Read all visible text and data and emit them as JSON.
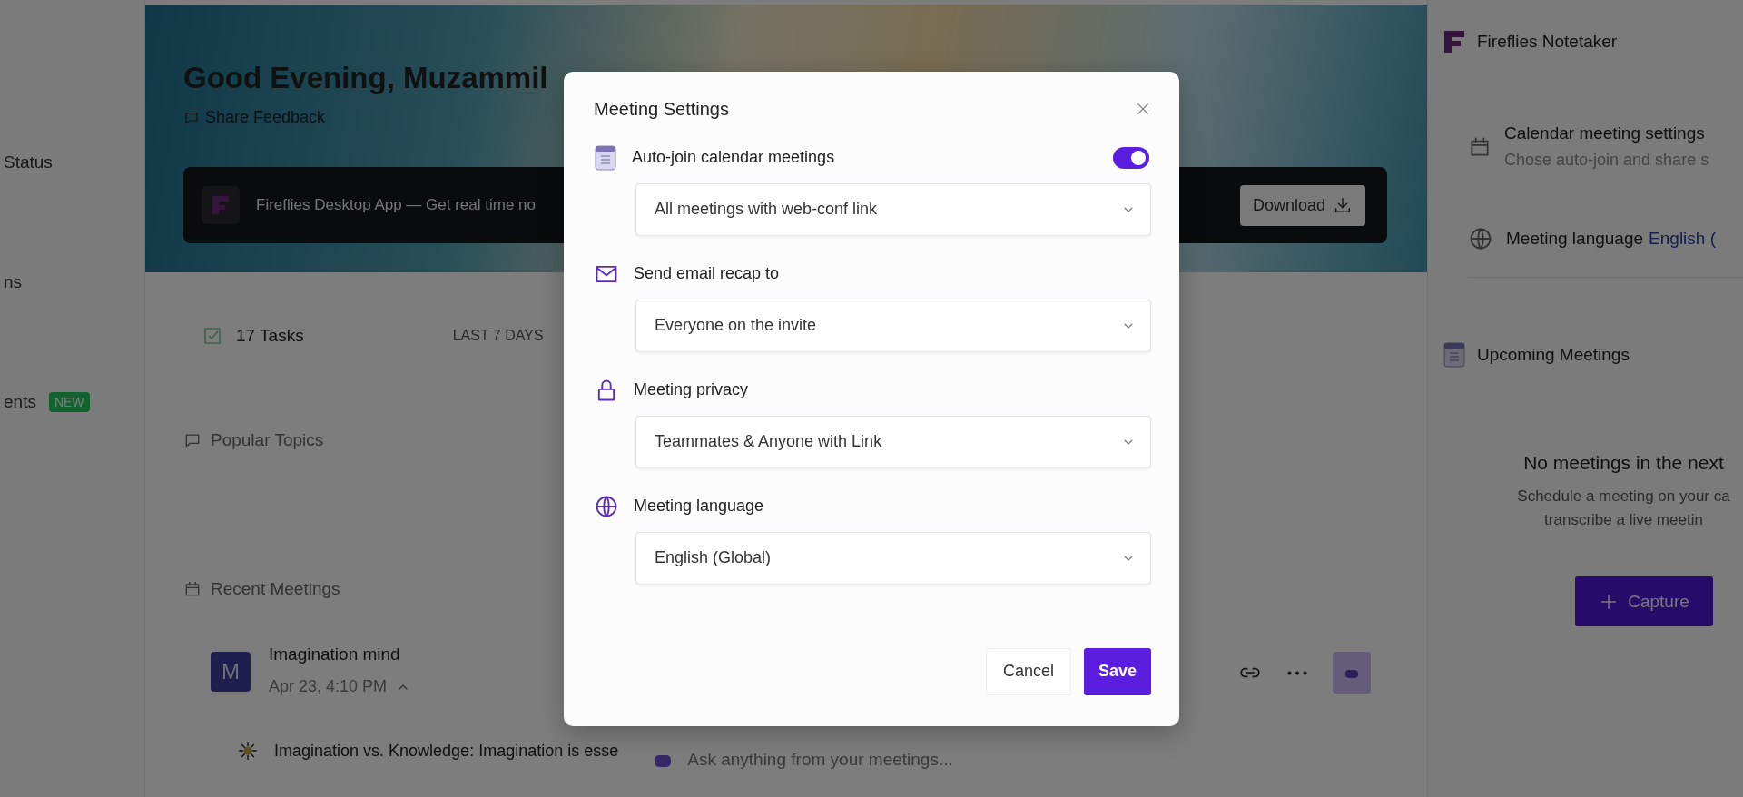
{
  "sidebar": {
    "items": [
      {
        "label": "Status"
      },
      {
        "label": "ns"
      },
      {
        "label": "ents",
        "badge": "NEW"
      }
    ]
  },
  "hero": {
    "greeting": "Good Evening, Muzammil",
    "feedback_link": "Share Feedback",
    "banner": {
      "text": "Fireflies Desktop App — Get real time no",
      "button": "Download"
    }
  },
  "stats": {
    "tasks": "17 Tasks",
    "period": "LAST 7 DAYS"
  },
  "popular_topics": {
    "title": "Popular Topics"
  },
  "recent_meetings": {
    "title": "Recent Meetings",
    "items": [
      {
        "avatar": "M",
        "title": "Imagination mind",
        "date": "Apr 23, 4:10 PM",
        "expanded": true,
        "summary": "Imagination vs. Knowledge: Imagination is esse"
      }
    ]
  },
  "chat": {
    "placeholder": "Ask anything from your meetings..."
  },
  "right_panel": {
    "title": "Fireflies Notetaker",
    "settings": [
      {
        "kind": "calendar",
        "title": "Calendar meeting settings",
        "subtitle": "Chose auto-join and share s"
      },
      {
        "kind": "language",
        "title": "Meeting language",
        "value": "English ("
      }
    ],
    "upcoming": {
      "title": "Upcoming Meetings",
      "empty_title": "No meetings in the next ",
      "empty_lines": [
        "Schedule a meeting on your ca",
        "transcribe a live meetin"
      ]
    },
    "capture_button": "Capture"
  },
  "dialog": {
    "title": "Meeting Settings",
    "settings": [
      {
        "kind": "calendar",
        "label": "Auto-join calendar meetings",
        "on": true,
        "value": "All meetings with web-conf link"
      },
      {
        "kind": "email",
        "label": "Send email recap to",
        "value": "Everyone on the invite"
      },
      {
        "kind": "lock",
        "label": "Meeting privacy",
        "value": "Teammates & Anyone with Link"
      },
      {
        "kind": "globe",
        "label": "Meeting language",
        "value": "English (Global)"
      }
    ],
    "buttons": [
      {
        "kind": "secondary",
        "label": "Cancel"
      },
      {
        "kind": "primary",
        "label": "Save"
      }
    ]
  }
}
